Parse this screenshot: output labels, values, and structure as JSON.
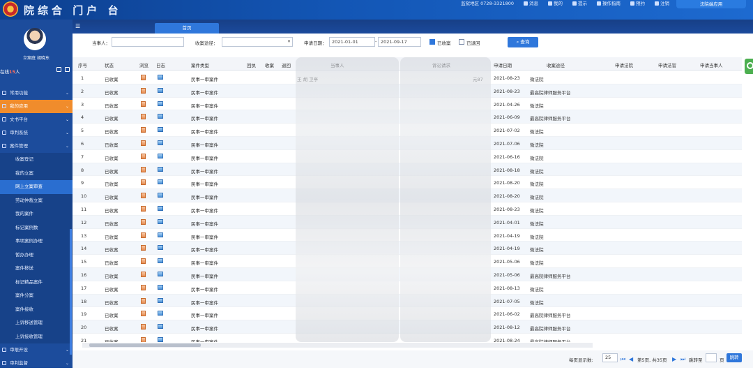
{
  "header": {
    "brand": "院综合  门户 台",
    "nav": [
      "监狱地区 0728-3321800",
      "消息",
      "我的",
      "提示",
      "操作指南",
      "预约",
      "注销"
    ],
    "login_button": "法院端应用"
  },
  "sidebar": {
    "user_name": "立案庭 胡晓东",
    "online_label": "在线",
    "online_count": "15",
    "online_suffix": "人",
    "menu": [
      {
        "label": "常用功能",
        "type": "group"
      },
      {
        "label": "我的应用",
        "type": "highlight"
      },
      {
        "label": "文书平台",
        "type": "group"
      },
      {
        "label": "审判系统",
        "type": "group"
      },
      {
        "label": "案件管理",
        "type": "group"
      },
      {
        "label": "收案登记",
        "type": "sub"
      },
      {
        "label": "我的立案",
        "type": "sub"
      },
      {
        "label": "网上立案审查",
        "type": "selected"
      },
      {
        "label": "劳动仲裁立案",
        "type": "sub"
      },
      {
        "label": "我的案件",
        "type": "sub"
      },
      {
        "label": "标记案例数",
        "type": "sub"
      },
      {
        "label": "事项案例办理",
        "type": "sub"
      },
      {
        "label": "暂办办理",
        "type": "sub"
      },
      {
        "label": "案件移送",
        "type": "sub"
      },
      {
        "label": "标记精品案件",
        "type": "sub"
      },
      {
        "label": "案件分案",
        "type": "sub"
      },
      {
        "label": "案件接收",
        "type": "sub"
      },
      {
        "label": "上诉移送管理",
        "type": "sub"
      },
      {
        "label": "上诉接收管理",
        "type": "sub"
      },
      {
        "label": "审限开设",
        "type": "group"
      },
      {
        "label": "审判监督",
        "type": "group"
      }
    ]
  },
  "tabs": {
    "active": "首页"
  },
  "filters": {
    "party_label": "当事人：",
    "channel_label": "收案途径：",
    "date_label": "申请日期：",
    "date_from": "2021-01-01",
    "date_to": "2021-09-17",
    "received_label": "已收案",
    "returned_label": "已退回",
    "query_button": "查询"
  },
  "table": {
    "columns": [
      "序号",
      "状态",
      "浏览",
      "日志",
      "案件类型",
      "回执",
      "收案",
      "退回",
      "当事人",
      "诉讼请求",
      "申请日期",
      "收案途径",
      "申请法院",
      "申请法官",
      "申请当事人"
    ],
    "rows": [
      {
        "no": "1",
        "status": "已收案",
        "type": "民事一审案件",
        "date": "2021-08-23",
        "channel": "微法院"
      },
      {
        "no": "2",
        "status": "已收案",
        "type": "民事一审案件",
        "date": "2021-08-23",
        "channel": "最高院律师服务平台"
      },
      {
        "no": "3",
        "status": "已收案",
        "type": "民事一审案件",
        "date": "2021-04-26",
        "channel": "微法院"
      },
      {
        "no": "4",
        "status": "已收案",
        "type": "民事一审案件",
        "date": "2021-06-09",
        "channel": "最高院律师服务平台"
      },
      {
        "no": "5",
        "status": "已收案",
        "type": "民事一审案件",
        "date": "2021-07-02",
        "channel": "微法院"
      },
      {
        "no": "6",
        "status": "已收案",
        "type": "民事一审案件",
        "date": "2021-07-06",
        "channel": "微法院"
      },
      {
        "no": "7",
        "status": "已收案",
        "type": "民事一审案件",
        "date": "2021-06-16",
        "channel": "微法院"
      },
      {
        "no": "8",
        "status": "已收案",
        "type": "民事一审案件",
        "date": "2021-08-18",
        "channel": "微法院"
      },
      {
        "no": "9",
        "status": "已收案",
        "type": "民事一审案件",
        "date": "2021-08-20",
        "channel": "微法院"
      },
      {
        "no": "10",
        "status": "已收案",
        "type": "民事一审案件",
        "date": "2021-08-20",
        "channel": "微法院"
      },
      {
        "no": "11",
        "status": "已收案",
        "type": "民事一审案件",
        "date": "2021-08-23",
        "channel": "微法院"
      },
      {
        "no": "12",
        "status": "已收案",
        "type": "民事一审案件",
        "date": "2021-04-01",
        "channel": "微法院"
      },
      {
        "no": "13",
        "status": "已收案",
        "type": "民事一审案件",
        "date": "2021-04-19",
        "channel": "微法院"
      },
      {
        "no": "14",
        "status": "已收案",
        "type": "民事一审案件",
        "date": "2021-04-19",
        "channel": "微法院"
      },
      {
        "no": "15",
        "status": "已收案",
        "type": "民事一审案件",
        "date": "2021-05-06",
        "channel": "微法院"
      },
      {
        "no": "16",
        "status": "已收案",
        "type": "民事一审案件",
        "date": "2021-05-06",
        "channel": "最高院律师服务平台"
      },
      {
        "no": "17",
        "status": "已收案",
        "type": "民事一审案件",
        "date": "2021-08-13",
        "channel": "微法院"
      },
      {
        "no": "18",
        "status": "已收案",
        "type": "民事一审案件",
        "date": "2021-07-05",
        "channel": "微法院"
      },
      {
        "no": "19",
        "status": "已收案",
        "type": "民事一审案件",
        "date": "2021-06-02",
        "channel": "最高院律师服务平台"
      },
      {
        "no": "20",
        "status": "已收案",
        "type": "民事一审案件",
        "date": "2021-08-12",
        "channel": "最高院律师服务平台"
      },
      {
        "no": "21",
        "status": "已收案",
        "type": "民事一审案件",
        "date": "2021-08-24",
        "channel": "最高院律师服务平台"
      }
    ],
    "row1_party_partial": "王   胡 卫亭",
    "row1_claim_partial": "元87"
  },
  "pager": {
    "per_page_label": "每页显示数:",
    "per_page": "25",
    "page_info": "第5页, 共35页",
    "goto_label": "跳转至",
    "page_suffix": "页",
    "jump_button": "跳转"
  }
}
